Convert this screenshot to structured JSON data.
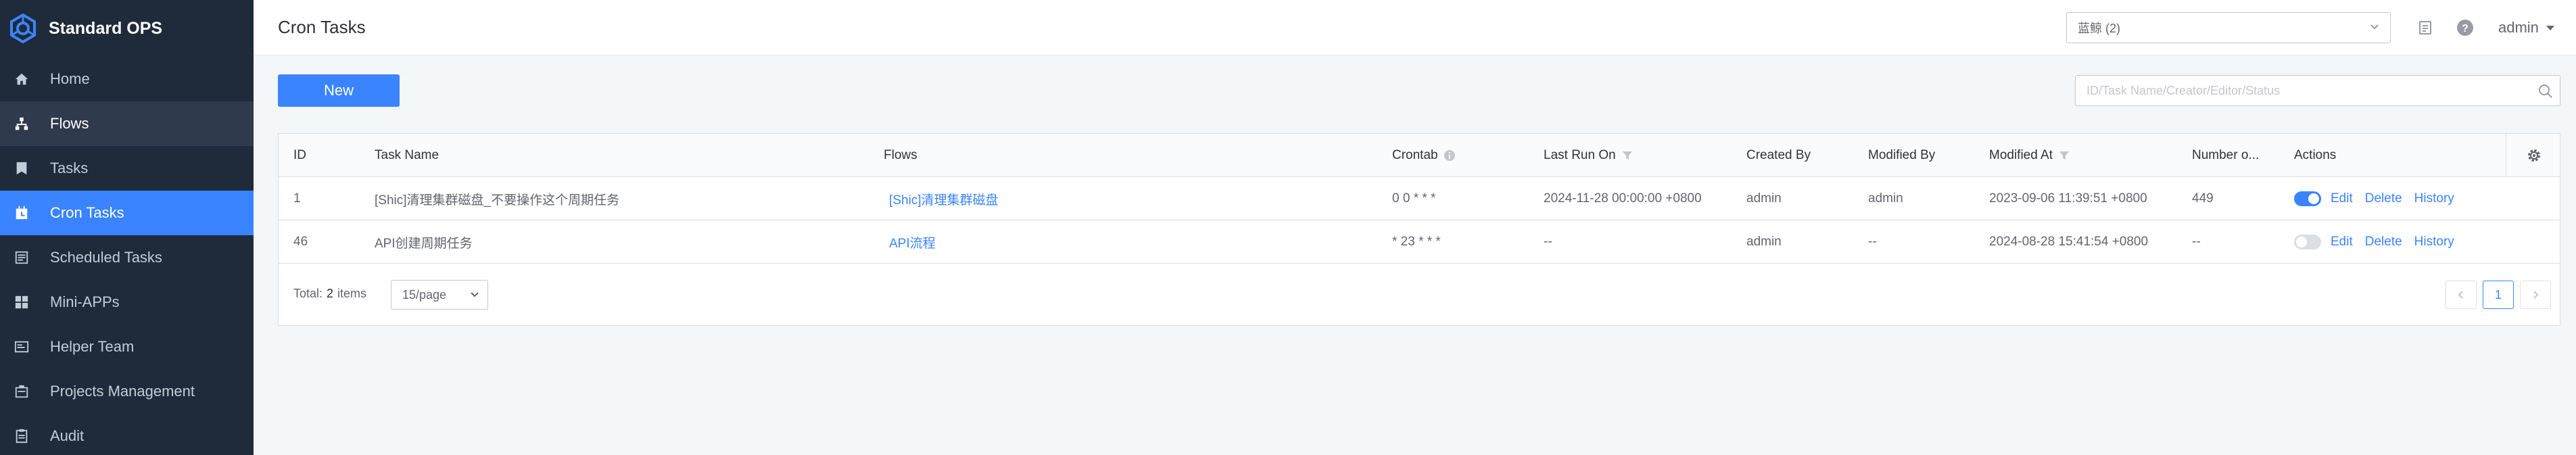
{
  "app": {
    "name": "Standard OPS"
  },
  "sidebar": {
    "items": [
      {
        "label": "Home",
        "icon": "home-icon"
      },
      {
        "label": "Flows",
        "icon": "flows-icon"
      },
      {
        "label": "Tasks",
        "icon": "tasks-icon"
      },
      {
        "label": "Cron Tasks",
        "icon": "cron-icon"
      },
      {
        "label": "Scheduled Tasks",
        "icon": "scheduled-icon"
      },
      {
        "label": "Mini-APPs",
        "icon": "apps-icon"
      },
      {
        "label": "Helper Team",
        "icon": "helper-icon"
      },
      {
        "label": "Projects Management",
        "icon": "projects-icon"
      },
      {
        "label": "Audit",
        "icon": "audit-icon"
      }
    ],
    "active": "Cron Tasks",
    "hover": "Flows"
  },
  "header": {
    "title": "Cron Tasks",
    "project_select": "蓝鲸 (2)",
    "user": "admin"
  },
  "toolbar": {
    "new_label": "New",
    "search_placeholder": "ID/Task Name/Creator/Editor/Status"
  },
  "table": {
    "columns": [
      "ID",
      "Task Name",
      "Flows",
      "Crontab",
      "Last Run On",
      "Created By",
      "Modified By",
      "Modified At",
      "Number o...",
      "Actions"
    ],
    "rows": [
      {
        "id": "1",
        "task_name": "[Shic]清理集群磁盘_不要操作这个周期任务",
        "flow": "[Shic]清理集群磁盘",
        "crontab": "0 0 * * *",
        "last_run": "2024-11-28 00:00:00 +0800",
        "created_by": "admin",
        "modified_by": "admin",
        "modified_at": "2023-09-06 11:39:51 +0800",
        "number": "449",
        "enabled": true
      },
      {
        "id": "46",
        "task_name": "API创建周期任务",
        "flow": "API流程",
        "crontab": "* 23 * * *",
        "last_run": "--",
        "created_by": "admin",
        "modified_by": "--",
        "modified_at": "2024-08-28 15:41:54 +0800",
        "number": "--",
        "enabled": false
      }
    ],
    "actions": {
      "edit": "Edit",
      "delete": "Delete",
      "history": "History"
    }
  },
  "pagination": {
    "total_label": "Total:",
    "total_count": "2",
    "total_unit": "items",
    "page_size": "15/page",
    "current_page": "1"
  },
  "colors": {
    "accent": "#3a84ff",
    "sidebar_bg": "#1f2b3a",
    "sidebar_hover": "#2f3b4c"
  }
}
